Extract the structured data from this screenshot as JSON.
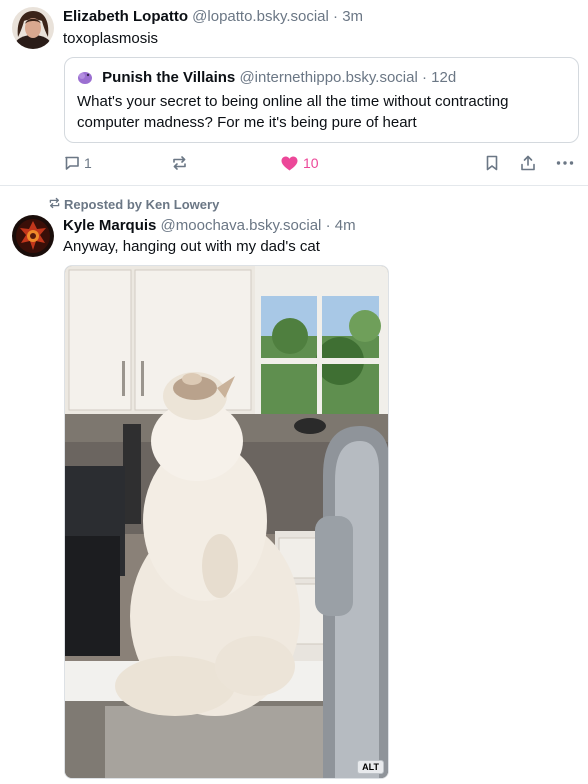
{
  "posts": [
    {
      "author_name": "Elizabeth Lopatto",
      "author_handle": "@lopatto.bsky.social",
      "separator": "·",
      "time": "3m",
      "text": "toxoplasmosis",
      "quote": {
        "author_name": "Punish the Villains",
        "author_handle": "@internethippo.bsky.social",
        "separator": "·",
        "time": "12d",
        "text": "What's your secret to being online all the time without contracting computer madness? For me it's being pure of heart"
      },
      "actions": {
        "reply_count": "1",
        "like_count": "10",
        "liked": true
      }
    },
    {
      "repost_label": "Reposted by Ken Lowery",
      "author_name": "Kyle Marquis",
      "author_handle": "@moochava.bsky.social",
      "separator": "·",
      "time": "4m",
      "text": "Anyway, hanging out with my dad's cat",
      "image_alt_badge": "ALT"
    }
  ],
  "colors": {
    "like_pink": "#ec4899",
    "muted_text": "#6b7785",
    "border": "#e4e8ec"
  },
  "icons": {
    "reply": "speech-bubble-icon",
    "repost": "repost-arrows-icon",
    "like": "heart-icon",
    "bookmark": "bookmark-icon",
    "share": "share-icon",
    "more": "ellipsis-icon"
  }
}
